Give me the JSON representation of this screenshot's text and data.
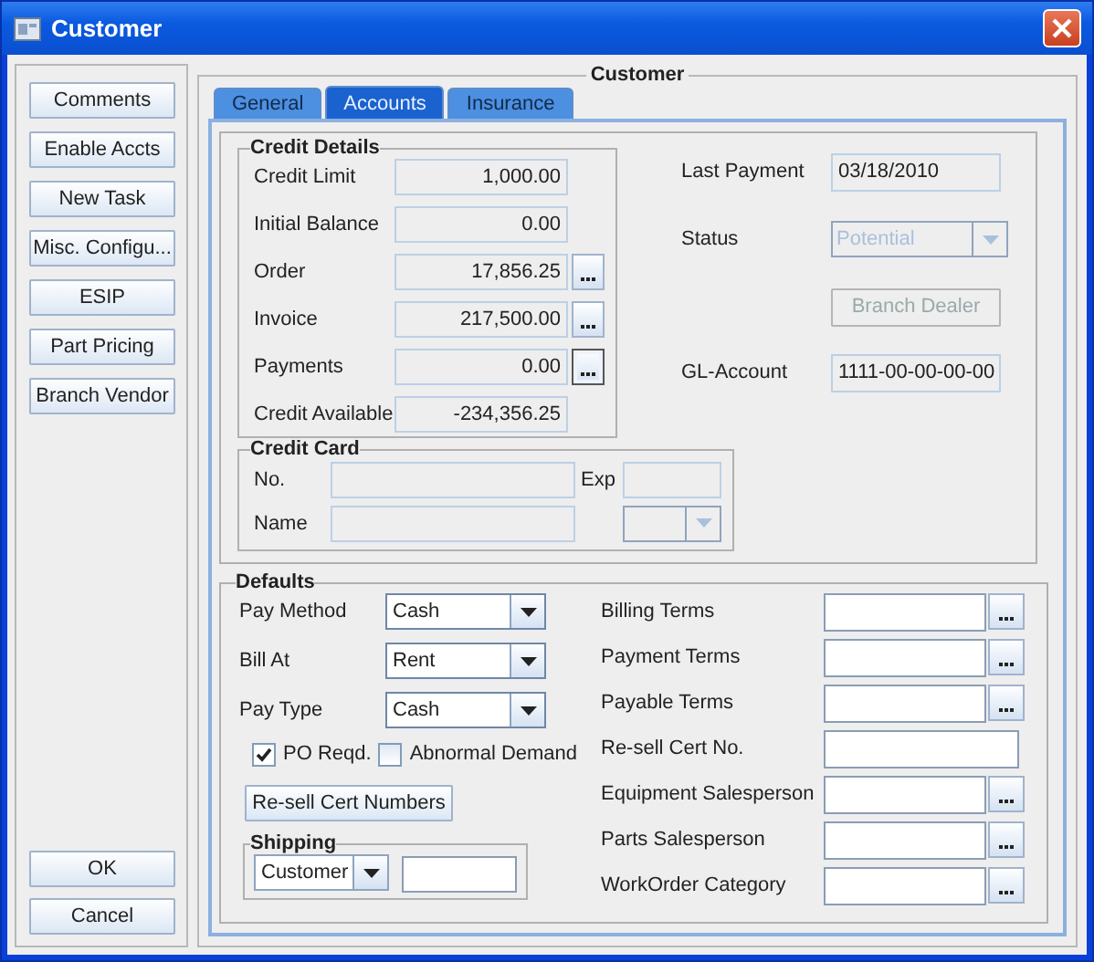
{
  "window": {
    "title": "Customer"
  },
  "sidebar": {
    "buttons": [
      "Comments",
      "Enable Accts",
      "New Task",
      "Misc. Configu...",
      "ESIP",
      "Part Pricing",
      "Branch Vendor"
    ],
    "dialog_buttons": [
      "OK",
      "Cancel"
    ]
  },
  "panel": {
    "title": "Customer",
    "tabs": [
      {
        "label": "General",
        "selected": false
      },
      {
        "label": "Accounts",
        "selected": true
      },
      {
        "label": "Insurance",
        "selected": false
      }
    ],
    "credit_details": {
      "title": "Credit Details",
      "rows": [
        {
          "label": "Credit Limit",
          "value": "1,000.00",
          "kind": "plain"
        },
        {
          "label": "Initial Balance",
          "value": "0.00",
          "kind": "plain"
        },
        {
          "label": "Order",
          "value": "17,856.25",
          "kind": "lookup",
          "focused": false
        },
        {
          "label": "Invoice",
          "value": "217,500.00",
          "kind": "lookup",
          "focused": false
        },
        {
          "label": "Payments",
          "value": "0.00",
          "kind": "lookup",
          "focused": true
        },
        {
          "label": "Credit Available",
          "value": "-234,356.25",
          "kind": "plain"
        }
      ]
    },
    "account_info": {
      "last_payment": {
        "label": "Last Payment",
        "value": "03/18/2010"
      },
      "status": {
        "label": "Status",
        "value": "Potential",
        "disabled": true
      },
      "branch_dealer_button": {
        "label": "Branch Dealer",
        "disabled": true
      },
      "gl_account": {
        "label": "GL-Account",
        "value": "1111-00-00-00-00"
      }
    },
    "credit_card": {
      "title": "Credit Card",
      "no_label": "No.",
      "exp_label": "Exp",
      "name_label": "Name"
    },
    "defaults": {
      "title": "Defaults",
      "combos": [
        {
          "label": "Pay Method",
          "value": "Cash"
        },
        {
          "label": "Bill At",
          "value": "Rent"
        },
        {
          "label": "Pay Type",
          "value": "Cash"
        }
      ],
      "checkboxes": [
        {
          "label": "PO Reqd.",
          "checked": true
        },
        {
          "label": "Abnormal Demand",
          "checked": false
        }
      ],
      "resell_button": "Re-sell Cert Numbers",
      "shipping": {
        "title": "Shipping",
        "value": "Customer"
      },
      "fields": [
        {
          "label": "Billing Terms",
          "kind": "lookup"
        },
        {
          "label": "Payment Terms",
          "kind": "lookup"
        },
        {
          "label": "Payable Terms",
          "kind": "lookup"
        },
        {
          "label": "Re-sell Cert No.",
          "kind": "plain"
        },
        {
          "label": "Equipment Salesperson",
          "kind": "lookup"
        },
        {
          "label": "Parts Salesperson",
          "kind": "lookup"
        },
        {
          "label": "WorkOrder Category",
          "kind": "lookup"
        }
      ]
    }
  }
}
